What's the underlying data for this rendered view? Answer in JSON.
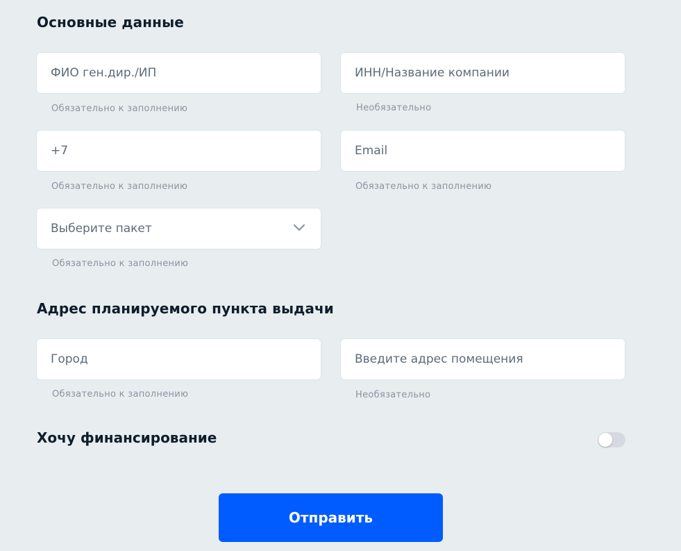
{
  "colors": {
    "background": "#e8edf0",
    "field_bg": "#ffffff",
    "accent": "#005cff",
    "title": "#0f1d2c",
    "hint": "#8a949e",
    "toggle_off": "#d4dae0"
  },
  "section_main": {
    "title": "Основные данные",
    "fields": {
      "fio": {
        "placeholder": "ФИО ген.дир./ИП",
        "hint": "Обязательно к заполнению"
      },
      "inn": {
        "placeholder": "ИНН/Название компании",
        "hint": "Необязательно"
      },
      "phone": {
        "value": "+7",
        "hint": "Обязательно к заполнению"
      },
      "email": {
        "placeholder": "Email",
        "hint": "Обязательно к заполнению"
      },
      "package": {
        "selected": "Выберите пакет",
        "icon": "chevron-down-icon",
        "hint": "Обязательно к заполнению"
      }
    }
  },
  "section_address": {
    "title": "Адрес планируемого пункта выдачи",
    "fields": {
      "city": {
        "placeholder": "Город",
        "hint": "Обязательно к заполнению"
      },
      "address": {
        "placeholder": "Введите адрес помещения",
        "hint": "Необязательно"
      }
    }
  },
  "financing": {
    "label": "Хочу финансирование",
    "enabled": false
  },
  "submit_label": "Отправить"
}
